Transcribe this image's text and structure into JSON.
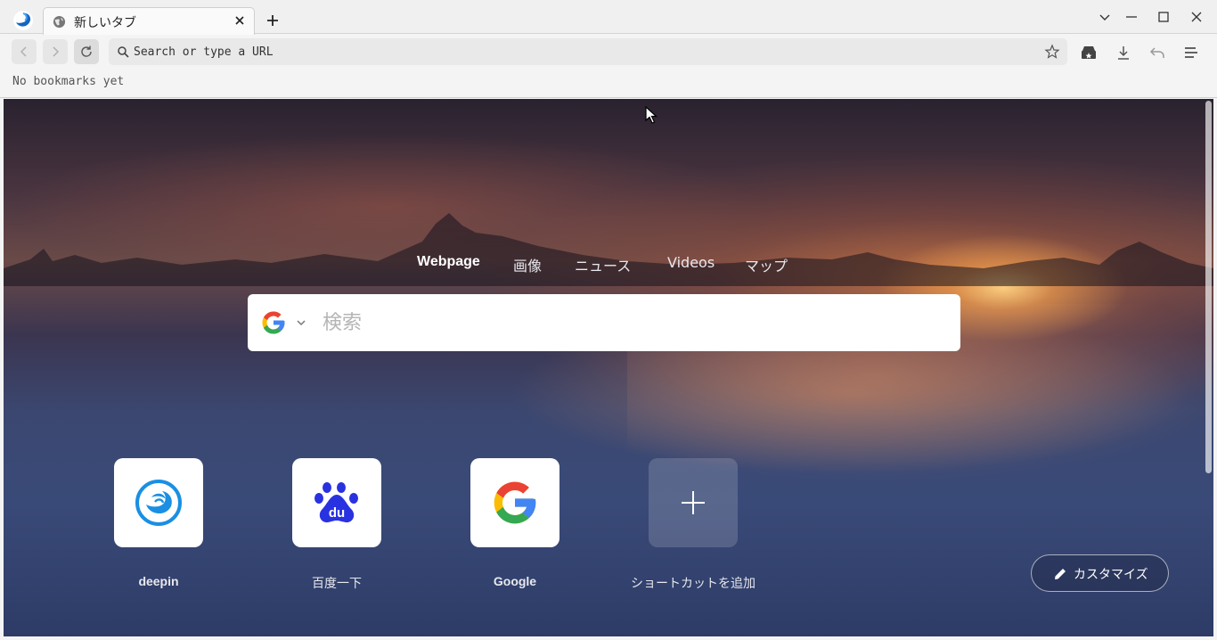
{
  "window": {
    "tab_title": "新しいタブ"
  },
  "toolbar": {
    "url_placeholder": "Search or type a URL"
  },
  "bookmarks_bar": {
    "empty_text": "No bookmarks yet"
  },
  "search": {
    "engine": "Google",
    "tabs": [
      {
        "label": "Webpage",
        "active": true
      },
      {
        "label": "画像",
        "active": false
      },
      {
        "label": "ニュース",
        "active": false
      },
      {
        "label": "Videos",
        "active": false
      },
      {
        "label": "マップ",
        "active": false
      }
    ],
    "placeholder": "検索"
  },
  "shortcuts": [
    {
      "label": "deepin",
      "icon": "deepin-logo-icon"
    },
    {
      "label": "百度一下",
      "icon": "baidu-paw-icon"
    },
    {
      "label": "Google",
      "icon": "google-g-icon"
    },
    {
      "label": "ショートカットを追加",
      "icon": "plus-icon"
    }
  ],
  "customize": {
    "label": "カスタマイズ",
    "icon": "pencil-icon"
  },
  "colors": {
    "deepin_blue": "#1a8fe3",
    "baidu_blue": "#2932e1",
    "google_blue": "#4285f4",
    "google_red": "#ea4335",
    "google_yellow": "#fbbc05",
    "google_green": "#34a853"
  }
}
